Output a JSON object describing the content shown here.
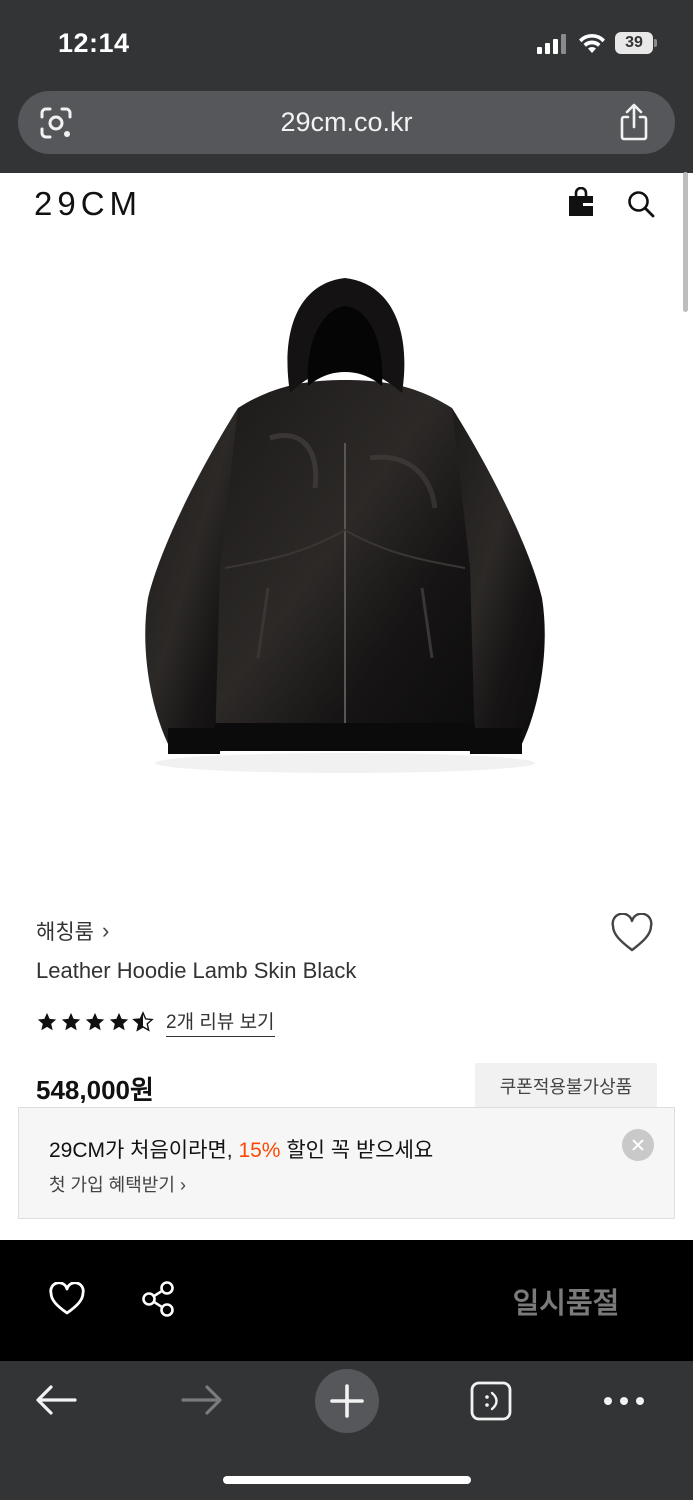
{
  "status_bar": {
    "time": "12:14",
    "battery": "39"
  },
  "browser": {
    "url": "29cm.co.kr"
  },
  "header": {
    "logo": "29CM"
  },
  "product": {
    "brand": "해칭룸",
    "name": "Leather Hoodie Lamb Skin Black",
    "rating": 4.5,
    "review_link": "2개 리뷰 보기",
    "price": "548,000원",
    "coupon_badge": "쿠폰적용불가상품"
  },
  "promo": {
    "title_before": "29CM가 처음이라면, ",
    "title_accent": "15%",
    "title_after": " 할인 꼭 받으세요",
    "subtitle": "첫 가입 혜택받기",
    "accent_color": "#ff4800"
  },
  "action_bar": {
    "soldout_label": "일시품절"
  },
  "icons": {
    "lens": "google-lens-icon",
    "share": "share-icon",
    "bag": "shopping-bag-icon",
    "search": "search-icon",
    "wish": "heart-icon",
    "back": "arrow-left-icon",
    "forward": "arrow-right-icon",
    "new_tab": "plus-icon",
    "tabs": "tabs-icon",
    "more": "more-dots-icon"
  }
}
